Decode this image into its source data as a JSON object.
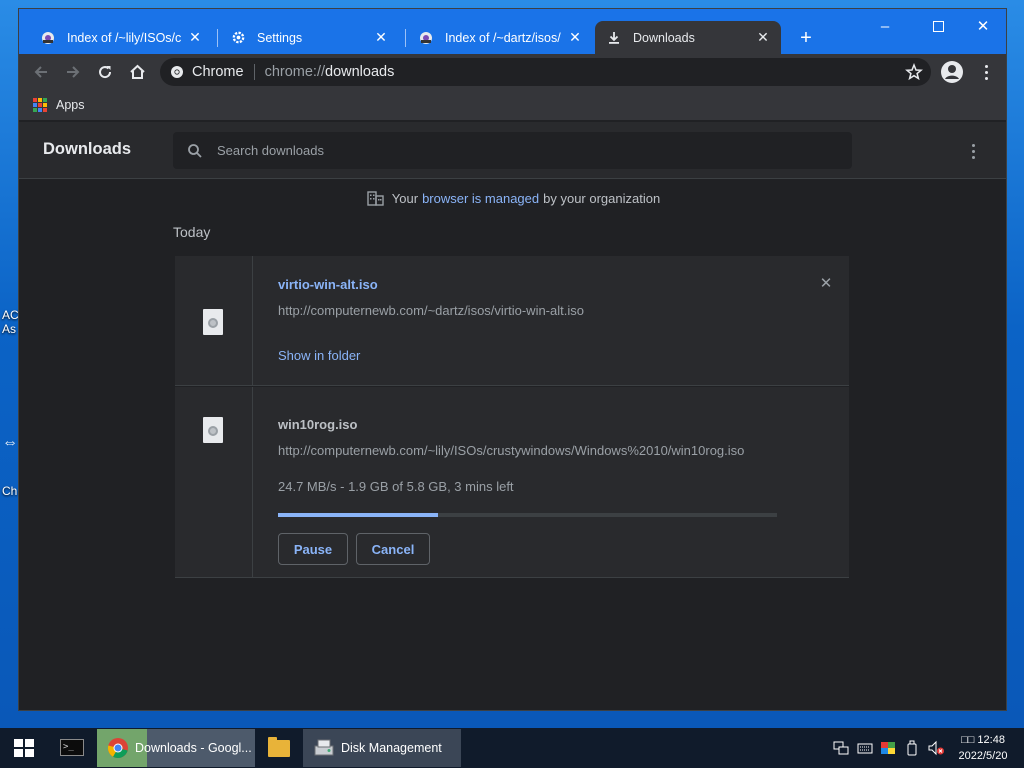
{
  "desktop": {
    "icon_label_1a": "AC",
    "icon_label_1b": "As",
    "icon_label_2": "Ch"
  },
  "browser": {
    "tabs": [
      {
        "title": "Index of /~lily/ISOs/crustywindows",
        "icon": "favicon-lily-icon"
      },
      {
        "title": "Settings",
        "icon": "gear-icon"
      },
      {
        "title": "Index of /~dartz/isos/",
        "icon": "favicon-dartz-icon"
      },
      {
        "title": "Downloads",
        "icon": "download-icon",
        "active": true
      }
    ],
    "omnibox": {
      "chip": "Chrome",
      "scheme": "chrome://",
      "host": "downloads"
    },
    "bookmarks": {
      "apps": "Apps"
    },
    "accent_color": "#1a73e8"
  },
  "downloads": {
    "title": "Downloads",
    "search_placeholder": "Search downloads",
    "managed_prefix": "Your",
    "managed_link": "browser is managed",
    "managed_suffix": "by your organization",
    "section_date": "Today",
    "items": [
      {
        "file_name": "virtio-win-alt.iso",
        "url": "http://computernewb.com/~dartz/isos/virtio-win-alt.iso",
        "action": "Show in folder"
      },
      {
        "file_name": "win10rog.iso",
        "url": "http://computernewb.com/~lily/ISOs/crustywindows/Windows%2010/win10rog.iso",
        "status": "24.7 MB/s - 1.9 GB of 5.8 GB, 3 mins left",
        "progress_fraction": 0.32,
        "pause_label": "Pause",
        "cancel_label": "Cancel"
      }
    ]
  },
  "taskbar": {
    "chrome_item": "Downloads - Googl...",
    "disk_item": "Disk Management",
    "clock_time": "□□ 12:48",
    "clock_date": "2022/5/20"
  }
}
